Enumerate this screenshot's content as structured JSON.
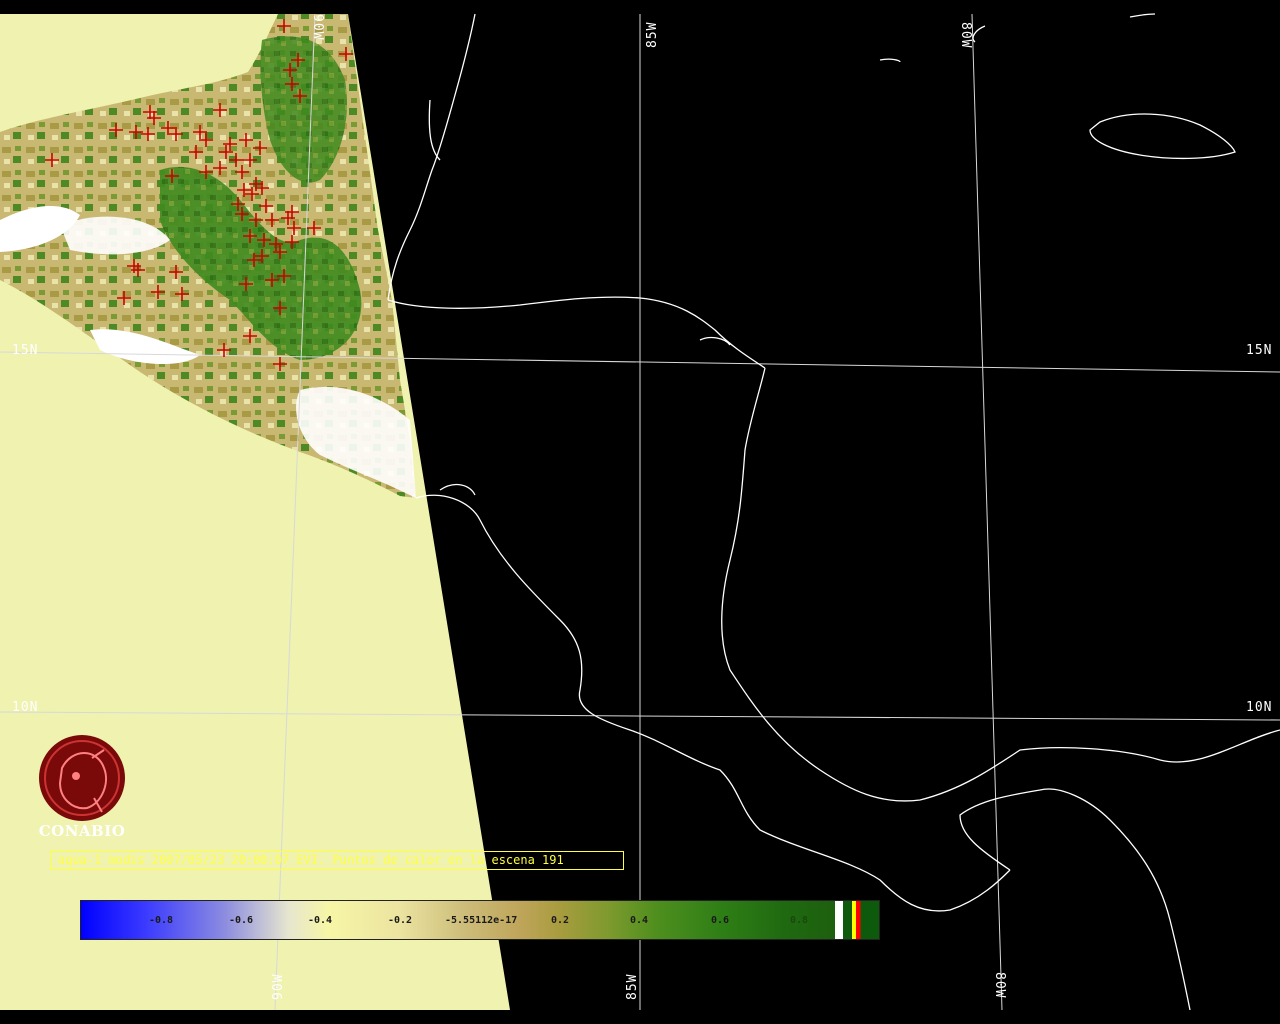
{
  "map": {
    "title": "aqua-1 modis 2007/05/23 20:00:07 EVI. Puntos de calor en la escena 191",
    "grid_labels": {
      "lat_15_left": "15N",
      "lat_15_right": "15N",
      "lat_10_left": "10N",
      "lat_10_right": "10N",
      "lon_90_top": "90W",
      "lon_90_bottom": "90W",
      "lon_85_top": "85W",
      "lon_85_bottom": "85W",
      "lon_80_top": "80W",
      "lon_80_bottom": "80W"
    },
    "logo_text": "CONABIO",
    "colors": {
      "background": "#000000",
      "no_data": "#f0f2b0",
      "coastline": "#ffffff",
      "hotspot": "#d00000",
      "caption": "#ffff40"
    },
    "hotspot_count": 191
  },
  "colorbar": {
    "ticks": [
      "-0.8",
      "-0.6",
      "-0.4",
      "-0.2",
      "-5.55112e-17",
      "0.2",
      "0.4",
      "0.6",
      "0.8"
    ],
    "range": [
      -1,
      1
    ],
    "colors": [
      "#0000ff",
      "#8c8ce0",
      "#f7f6a6",
      "#cdbd7a",
      "#a89c3e",
      "#4f8f1e",
      "#1f6a10"
    ]
  }
}
